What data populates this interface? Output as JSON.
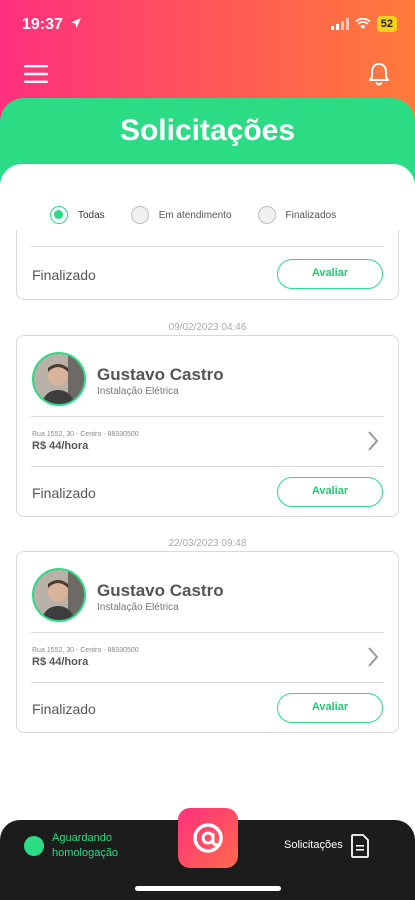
{
  "status_bar": {
    "time": "19:37",
    "battery": "52"
  },
  "header": {
    "title": "Solicitações"
  },
  "filters": [
    {
      "label": "Todas",
      "selected": true
    },
    {
      "label": "Em atendimento",
      "selected": false
    },
    {
      "label": "Finalizados",
      "selected": false
    }
  ],
  "top_card": {
    "status": "Finalizado",
    "action": "Avaliar"
  },
  "requests": [
    {
      "date": "09/02/2023 04:46",
      "name": "Gustavo Castro",
      "service": "Instalação Elétrica",
      "address": "Rua 1552, 30 - Centro - 88330500",
      "price": "R$ 44/hora",
      "status": "Finalizado",
      "action": "Avaliar"
    },
    {
      "date": "22/03/2023 09:48",
      "name": "Gustavo Castro",
      "service": "Instalação Elétrica",
      "address": "Rua 1552, 30 - Centro - 88330500",
      "price": "R$ 44/hora",
      "status": "Finalizado",
      "action": "Avaliar"
    }
  ],
  "bottom_bar": {
    "status_label": "Aguardando homologação",
    "solicitacoes_label": "Solicitações",
    "center_icon": "at-sign-icon",
    "doc_icon": "document-icon"
  },
  "colors": {
    "accent_green": "#2bdc84",
    "brand_pink": "#ff2f7e",
    "brand_orange": "#ff7b3a"
  }
}
